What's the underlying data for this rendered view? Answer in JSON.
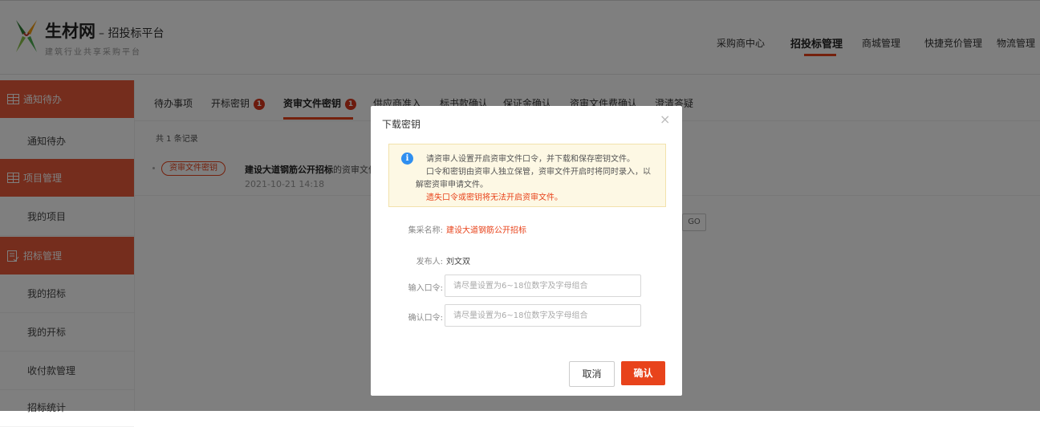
{
  "header": {
    "brand": "生材网",
    "brand_sub": "– 招投标平台",
    "brand_tagline": "建筑行业共享采购平台",
    "nav": [
      {
        "label": "采购商中心",
        "active": false
      },
      {
        "label": "招投标管理",
        "active": true
      },
      {
        "label": "商城管理",
        "active": false
      },
      {
        "label": "快捷竞价管理",
        "active": false
      },
      {
        "label": "物流管理",
        "active": false
      }
    ]
  },
  "sidebar": {
    "groups": [
      {
        "label": "通知待办",
        "icon": "grid-book-icon",
        "items": [
          "通知待办"
        ]
      },
      {
        "label": "项目管理",
        "icon": "grid-book-icon",
        "items": [
          "我的项目"
        ]
      },
      {
        "label": "招标管理",
        "icon": "document-check-icon",
        "items": [
          "我的招标",
          "我的开标",
          "收付款管理",
          "招标统计"
        ]
      }
    ]
  },
  "tabs": [
    {
      "label": "待办事项",
      "count": null
    },
    {
      "label": "开标密钥",
      "count": "1"
    },
    {
      "label": "资审文件密钥",
      "count": "1",
      "active": true
    },
    {
      "label": "供应商准入",
      "count": null
    },
    {
      "label": "标书款确认",
      "count": null
    },
    {
      "label": "保证金确认",
      "count": null
    },
    {
      "label": "资审文件费确认",
      "count": null
    },
    {
      "label": "澄清答疑",
      "count": null
    }
  ],
  "records": {
    "summary": "共 1 条记录",
    "rows": [
      {
        "badge": "资审文件密钥",
        "title": "建设大道钢筋公开招标",
        "suffix": "的资审文件密",
        "date": "2021-10-21 14:18"
      }
    ]
  },
  "pager": {
    "go_label": "GO"
  },
  "dialog": {
    "title": "下载密钥",
    "close": "×",
    "tip": {
      "line1": "请资审人设置开启资审文件口令，并下载和保存密钥文件。",
      "line2": "口令和密钥由资审人独立保管，资审文件开启时将同时录入，以",
      "line3": "解密资审申请文件。",
      "warning": "遗失口令或密钥将无法开启资审文件。"
    },
    "fields": {
      "project_label": "集采名称:",
      "project_value": "建设大道钢筋公开招标",
      "publisher_label": "发布人:",
      "publisher_value": "刘文双",
      "password_label": "输入口令:",
      "password_placeholder": "请尽量设置为6~18位数字及字母组合",
      "confirm_label": "确认口令:",
      "confirm_placeholder": "请尽量设置为6~18位数字及字母组合"
    },
    "cancel_label": "取消",
    "ok_label": "确认"
  },
  "colors": {
    "accent": "#e8431b",
    "sidebar_group": "#ea5b3a",
    "tip_bg": "#fdf8e4",
    "info_icon": "#2f8ff0"
  }
}
